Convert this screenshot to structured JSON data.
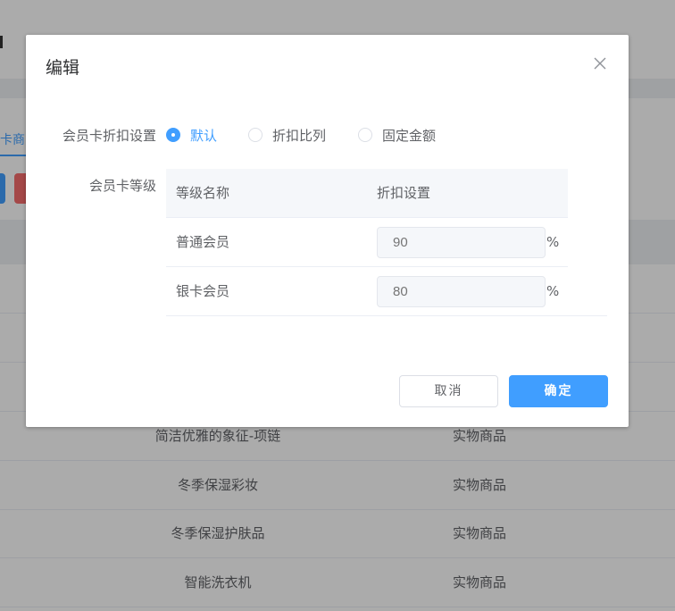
{
  "background": {
    "tab_label": "卡商",
    "rows": [
      {
        "name": "简洁优雅的象征-项链",
        "type": "实物商品"
      },
      {
        "name": "冬季保湿彩妆",
        "type": "实物商品"
      },
      {
        "name": "冬季保湿护肤品",
        "type": "实物商品"
      },
      {
        "name": "智能洗衣机",
        "type": "实物商品"
      }
    ]
  },
  "dialog": {
    "title": "编辑",
    "close_icon": "close-icon",
    "discount_setting_label": "会员卡折扣设置",
    "discount_options": [
      {
        "label": "默认",
        "checked": true
      },
      {
        "label": "折扣比列",
        "checked": false
      },
      {
        "label": "固定金额",
        "checked": false
      }
    ],
    "level_label": "会员卡等级",
    "table": {
      "headers": [
        "等级名称",
        "折扣设置"
      ],
      "rows": [
        {
          "level": "普通会员",
          "placeholder": "90",
          "unit": "%"
        },
        {
          "level": "银卡会员",
          "placeholder": "80",
          "unit": "%"
        }
      ]
    },
    "cancel_label": "取消",
    "ok_label": "确定"
  },
  "colors": {
    "primary": "#409eff",
    "danger": "#f56c6c",
    "text": "#606266",
    "overlay": "rgba(0,0,0,0.33)"
  }
}
